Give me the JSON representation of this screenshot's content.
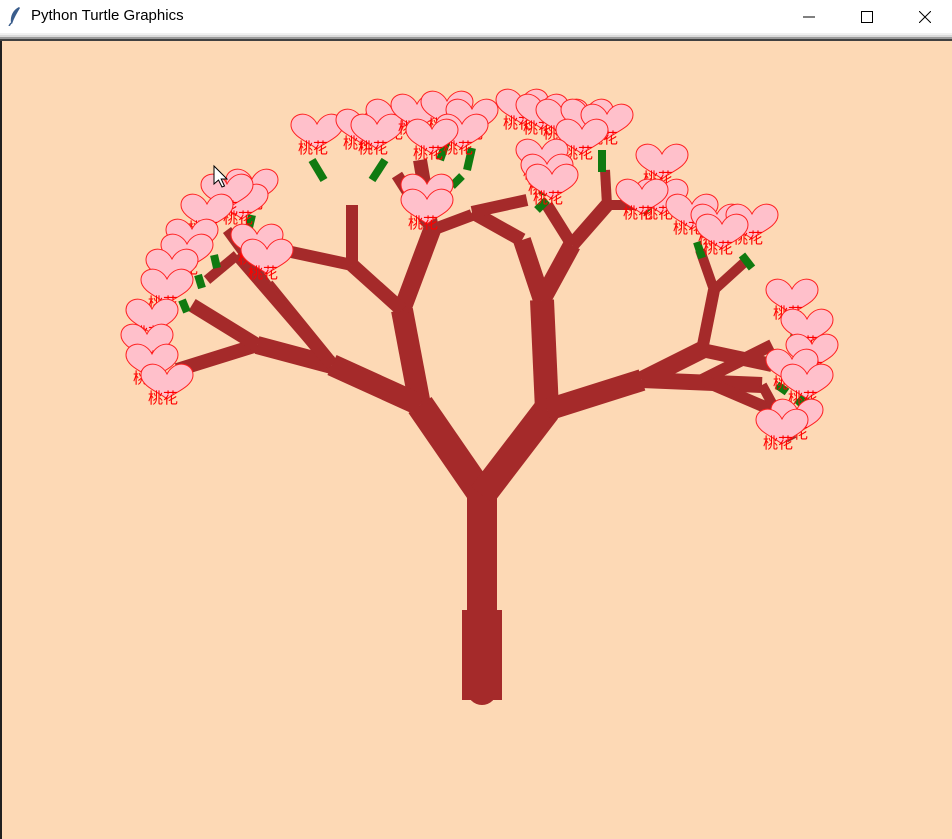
{
  "window": {
    "title": "Python Turtle Graphics",
    "buttons": {
      "minimize": "minimize",
      "maximize": "maximize",
      "close": "close"
    }
  },
  "canvas": {
    "background": "#fdd9b5",
    "trunk_color": "#a52a2a",
    "leaf_color": "#107a10",
    "blossom_fill": "#ffc0cb",
    "blossom_stroke": "#ff2020",
    "blossom_label": "桃花"
  },
  "icons": {
    "app": "feather-icon",
    "cursor": "mouse-pointer-icon"
  }
}
